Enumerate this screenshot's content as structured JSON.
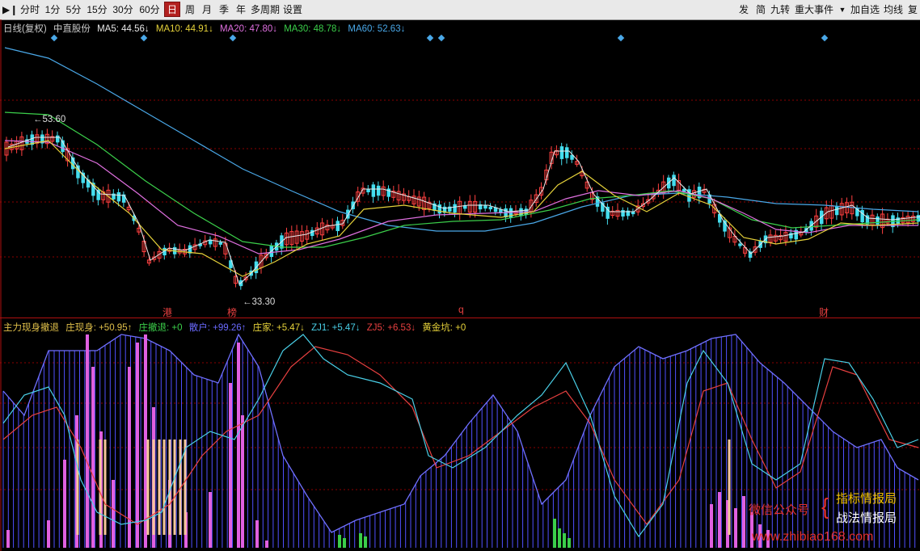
{
  "toolbar": {
    "items": [
      {
        "label": "分时"
      },
      {
        "label": "1分"
      },
      {
        "label": "5分"
      },
      {
        "label": "15分"
      },
      {
        "label": "30分"
      },
      {
        "label": "60分"
      },
      {
        "label": "日"
      },
      {
        "label": "周"
      },
      {
        "label": "月"
      },
      {
        "label": "季"
      },
      {
        "label": "年"
      },
      {
        "label": "多周期"
      },
      {
        "label": "设置"
      }
    ],
    "right_items": [
      {
        "label": "发"
      },
      {
        "label": "简"
      },
      {
        "label": "九转"
      },
      {
        "label": "重大事件"
      },
      {
        "label": "▼"
      },
      {
        "label": "加自选"
      },
      {
        "label": "均线"
      },
      {
        "label": "复"
      }
    ],
    "toggle_icon": "▶❙"
  },
  "main_panel": {
    "period": "日线(复权)",
    "stock_name": "中直股份",
    "ma": [
      {
        "label": "MA5: 44.56↓",
        "color": "#e8e8e8"
      },
      {
        "label": "MA10: 44.91↓",
        "color": "#e6d23a"
      },
      {
        "label": "MA20: 47.80↓",
        "color": "#e070e0"
      },
      {
        "label": "MA30: 48.78↓",
        "color": "#3bcf4a"
      },
      {
        "label": "MA60: 52.63↓",
        "color": "#4aa8e8"
      }
    ],
    "high_label": "53.60",
    "low_label": "33.30",
    "event_markers": [
      {
        "label": "港",
        "color": "#e84040"
      },
      {
        "label": "榜",
        "color": "#e84040"
      },
      {
        "label": "q",
        "color": "#e84040"
      },
      {
        "label": "财",
        "color": "#e84040"
      }
    ]
  },
  "indicator_panel": {
    "name": "主力现身撤退",
    "values": [
      {
        "label": "庄现身: +50.95↑",
        "color": "#e0c04a"
      },
      {
        "label": "庄撤退: +0",
        "color": "#3bcf4a"
      },
      {
        "label": "散户: +99.26↑",
        "color": "#6a6aff"
      },
      {
        "label": "庄家: +5.47↓",
        "color": "#e6d23a"
      },
      {
        "label": "ZJ1: +5.47↓",
        "color": "#4ad0e8"
      },
      {
        "label": "ZJ5: +6.53↓",
        "color": "#e84040"
      },
      {
        "label": "黄金坑: +0",
        "color": "#e6d23a"
      }
    ]
  },
  "watermark": {
    "left": "微信公众号",
    "line1": "指标情报局",
    "line2": "战法情报局",
    "url": "www.zhibiao168.com"
  },
  "colors": {
    "up": "#ff4040",
    "down": "#44ddee",
    "grid": "#8b0000",
    "volume_bar": "#5050ff",
    "pink_bar": "#e060e0",
    "peach_bar": "#f5c79a",
    "green_bar": "#3bcf4a"
  }
}
